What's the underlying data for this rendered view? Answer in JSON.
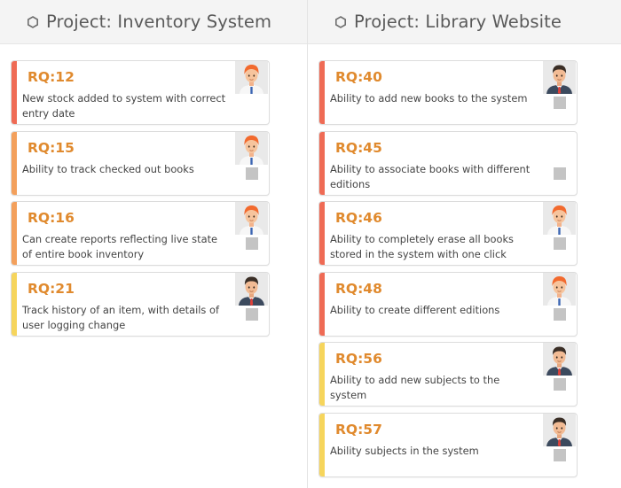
{
  "columns": [
    {
      "title": "Project: Inventory System",
      "cards": [
        {
          "id": "RQ:12",
          "description": "New stock added to system with correct entry date",
          "priority_color": "#ef6b55",
          "assignee": "female-red-hair-avatar",
          "has_checkbox": false
        },
        {
          "id": "RQ:15",
          "description": "Ability to track checked out books",
          "priority_color": "#f3a05c",
          "assignee": "female-red-hair-avatar",
          "has_checkbox": true
        },
        {
          "id": "RQ:16",
          "description": "Can create reports reflecting live state of entire book inventory",
          "priority_color": "#f3a05c",
          "assignee": "female-red-hair-avatar",
          "has_checkbox": true
        },
        {
          "id": "RQ:21",
          "description": "Track history of an item, with details of user logging change",
          "priority_color": "#f6d55c",
          "assignee": "male-suit-avatar",
          "has_checkbox": true
        }
      ]
    },
    {
      "title": "Project: Library Website",
      "cards": [
        {
          "id": "RQ:40",
          "description": "Ability to add new books to the system",
          "priority_color": "#ef6b55",
          "assignee": "male-suit-avatar",
          "has_checkbox": true
        },
        {
          "id": "RQ:45",
          "description": "Ability to associate books with different editions",
          "priority_color": "#ef6b55",
          "assignee": "",
          "has_checkbox": true
        },
        {
          "id": "RQ:46",
          "description": "Ability to completely erase all books stored in the system with one click",
          "priority_color": "#ef6b55",
          "assignee": "female-red-hair-avatar",
          "has_checkbox": true
        },
        {
          "id": "RQ:48",
          "description": "Ability to create different editions",
          "priority_color": "#ef6b55",
          "assignee": "female-red-hair-avatar",
          "has_checkbox": true
        },
        {
          "id": "RQ:56",
          "description": "Ability to add new subjects to the system",
          "priority_color": "#f6d55c",
          "assignee": "male-suit-avatar",
          "has_checkbox": true
        },
        {
          "id": "RQ:57",
          "description": "Ability subjects in the system",
          "priority_color": "#f6d55c",
          "assignee": "male-suit-avatar",
          "has_checkbox": true
        }
      ]
    }
  ],
  "icons": {
    "column_header": "hexagon-icon"
  },
  "colors": {
    "rq_id": "#e08a2e",
    "header_bg": "#f4f4f4",
    "checkbox": "#c4c4c4"
  }
}
